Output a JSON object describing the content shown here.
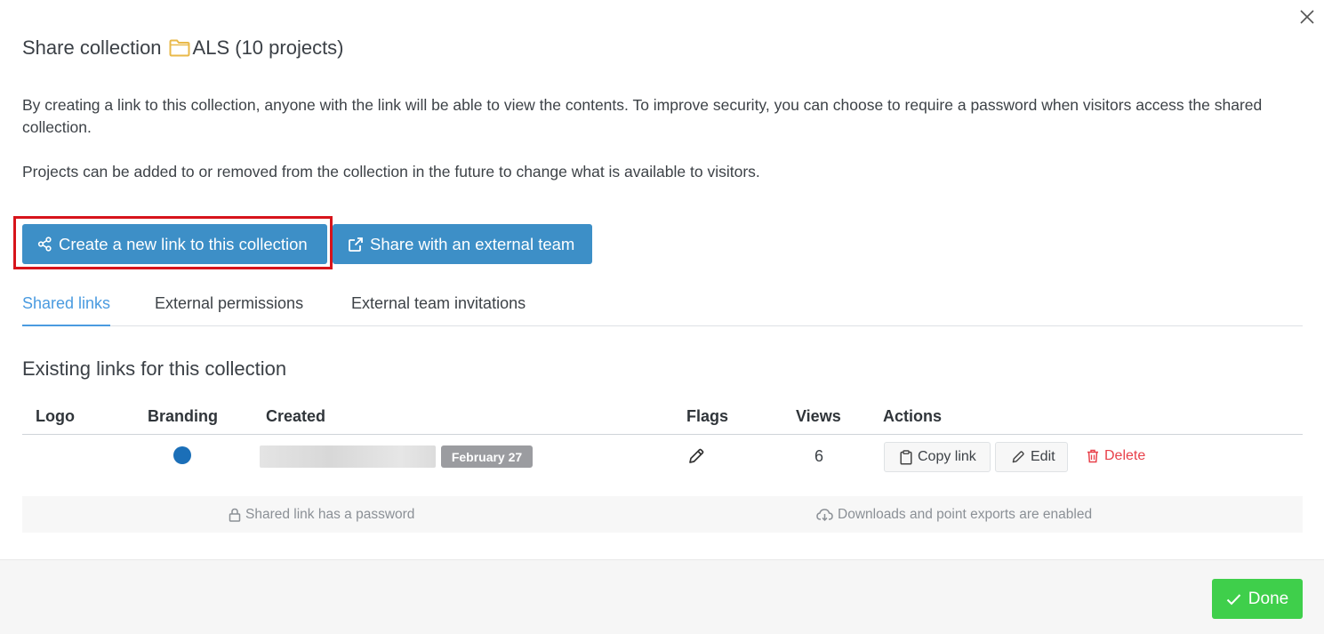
{
  "dialog": {
    "title_prefix": "Share collection",
    "collection_name": "ALS (10 projects)",
    "description_1": "By creating a link to this collection, anyone with the link will be able to view the contents. To improve security, you can choose to require a password when visitors access the shared collection.",
    "description_2": "Projects can be added to or removed from the collection in the future to change what is available to visitors."
  },
  "buttons": {
    "create_link": "Create a new link to this collection",
    "share_external": "Share with an external team",
    "done": "Done"
  },
  "tabs": [
    {
      "label": "Shared links",
      "active": true
    },
    {
      "label": "External permissions",
      "active": false
    },
    {
      "label": "External team invitations",
      "active": false
    }
  ],
  "links_section": {
    "title": "Existing links for this collection",
    "columns": [
      "Logo",
      "Branding",
      "Created",
      "Flags",
      "Views",
      "Actions"
    ],
    "rows": [
      {
        "branding_color": "#1b6fb8",
        "created_badge": "February 27",
        "views": "6",
        "actions": {
          "copy": "Copy link",
          "edit": "Edit",
          "delete": "Delete"
        }
      }
    ],
    "info": {
      "password": "Shared link has a password",
      "downloads": "Downloads and point exports are enabled"
    }
  },
  "colors": {
    "primary": "#3d8fc7",
    "tab_active": "#4a9be0",
    "done": "#3fcf4b",
    "danger": "#e8414a",
    "folder": "#e9b949",
    "highlight": "#d7141b"
  }
}
